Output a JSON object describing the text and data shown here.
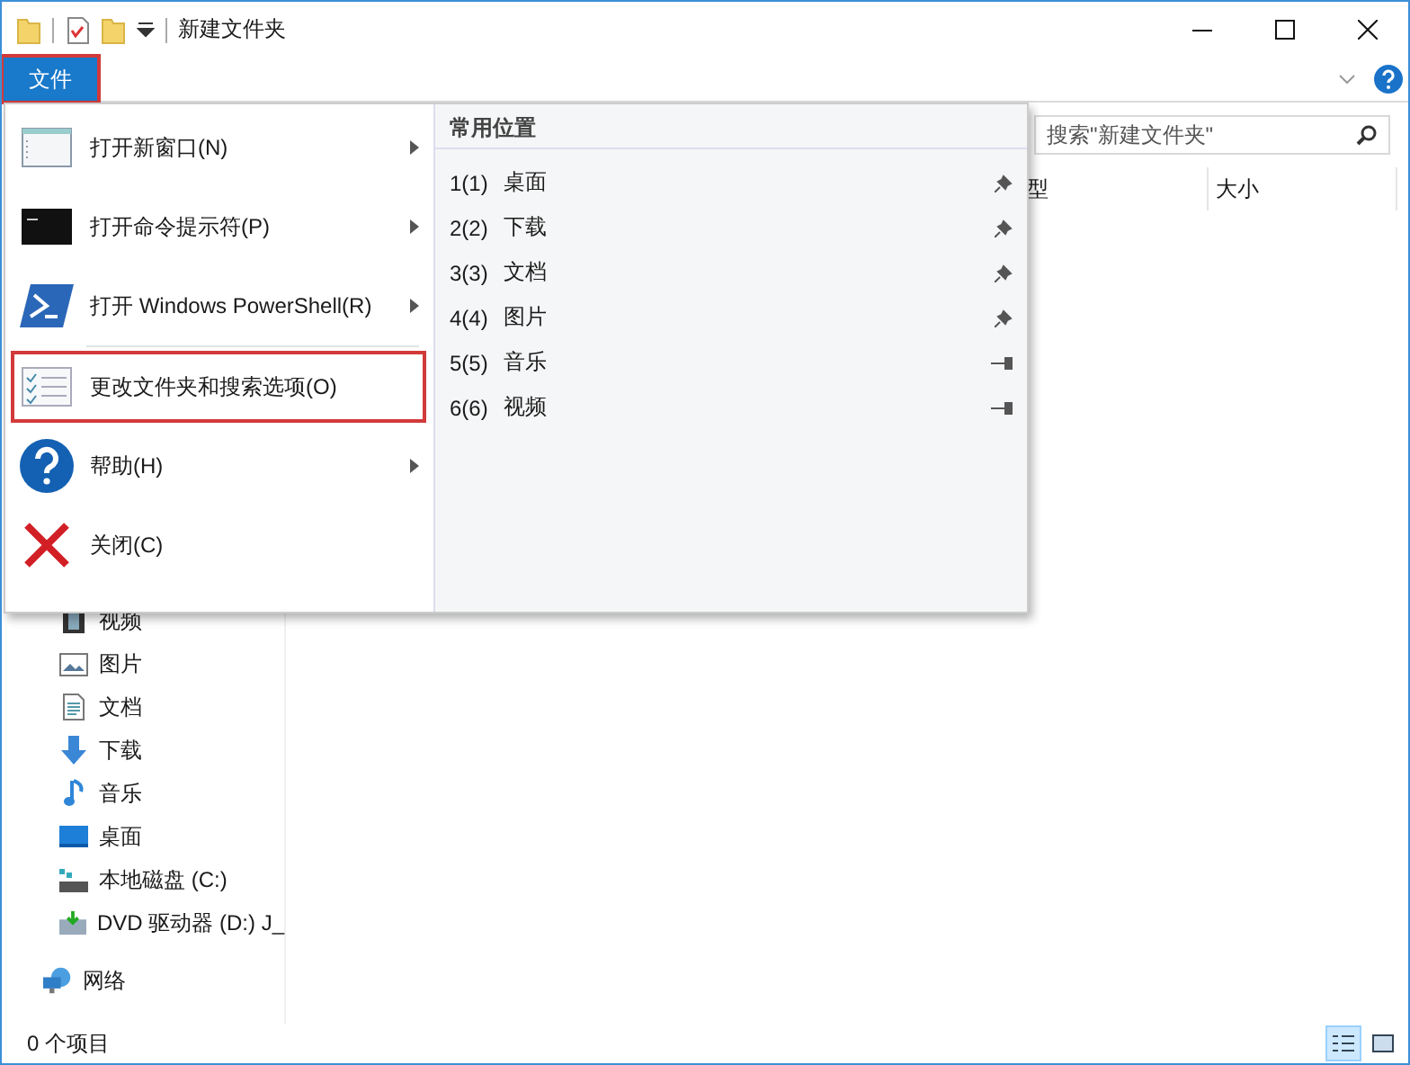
{
  "window": {
    "title": "新建文件夹"
  },
  "ribbon": {
    "tabs": [
      {
        "label": "文件",
        "selected": true,
        "highlighted": true
      }
    ]
  },
  "search": {
    "placeholder": "搜索\"新建文件夹\""
  },
  "columns": [
    {
      "label": "型"
    },
    {
      "label": "大小"
    }
  ],
  "file_menu": {
    "items": [
      {
        "label": "打开新窗口(N)",
        "submenu": true,
        "highlighted": false
      },
      {
        "label": "打开命令提示符(P)",
        "submenu": true,
        "highlighted": false
      },
      {
        "label": "打开 Windows PowerShell(R)",
        "submenu": true,
        "highlighted": false
      },
      {
        "label": "更改文件夹和搜索选项(O)",
        "submenu": false,
        "highlighted": true
      },
      {
        "label": "帮助(H)",
        "submenu": true,
        "highlighted": false
      },
      {
        "label": "关闭(C)",
        "submenu": false,
        "highlighted": false
      }
    ],
    "frequent_places": {
      "title": "常用位置",
      "items": [
        {
          "key": "1(1)",
          "label": "桌面",
          "pinned": true
        },
        {
          "key": "2(2)",
          "label": "下载",
          "pinned": true
        },
        {
          "key": "3(3)",
          "label": "文档",
          "pinned": true
        },
        {
          "key": "4(4)",
          "label": "图片",
          "pinned": true
        },
        {
          "key": "5(5)",
          "label": "音乐",
          "pinned": false
        },
        {
          "key": "6(6)",
          "label": "视频",
          "pinned": false
        }
      ]
    }
  },
  "nav": {
    "items": [
      "视频",
      "图片",
      "文档",
      "下载",
      "音乐",
      "桌面",
      "本地磁盘 (C:)",
      "DVD 驱动器 (D:) J_"
    ],
    "network": "网络"
  },
  "status_bar": {
    "text": "0 个项目",
    "views": [
      {
        "kind": "details",
        "selected": true
      },
      {
        "kind": "large",
        "selected": false
      }
    ]
  }
}
